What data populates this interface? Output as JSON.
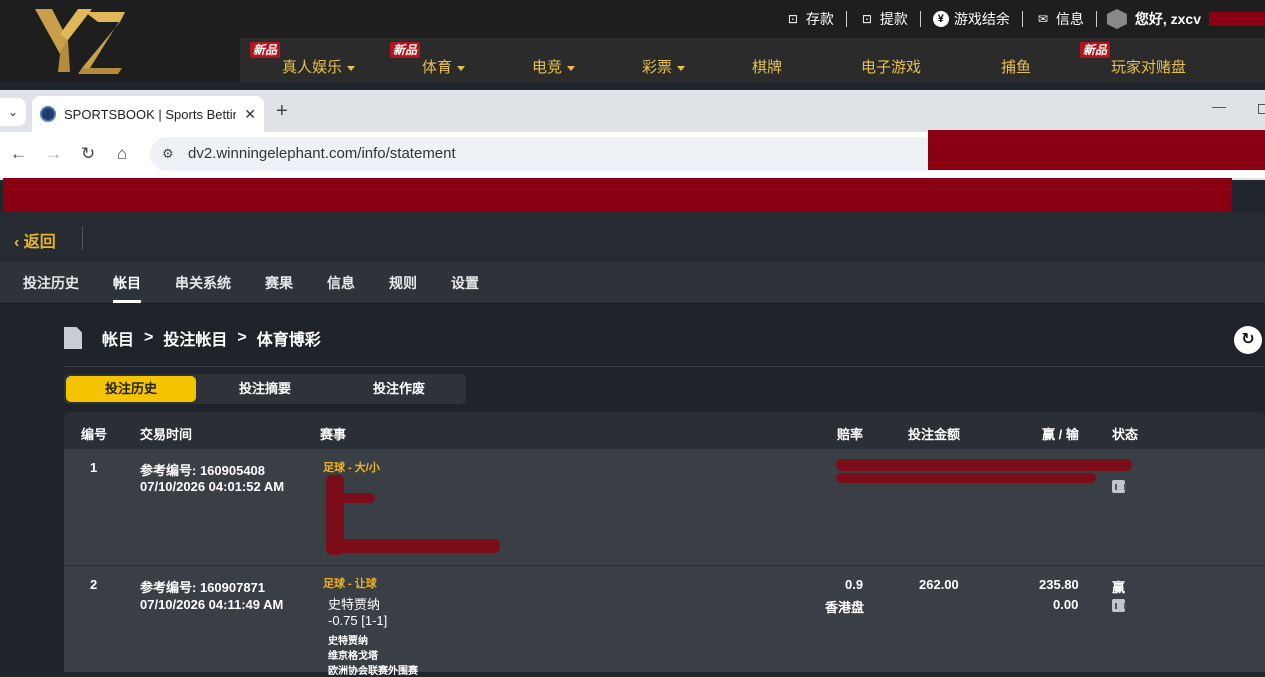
{
  "site": {
    "logo_text": "YZ",
    "top_links": [
      {
        "icon": "deposit-icon",
        "label": "存款"
      },
      {
        "icon": "withdraw-icon",
        "label": "提款"
      },
      {
        "icon": "yen-coin-icon",
        "label": "游戏结余"
      },
      {
        "icon": "mail-icon",
        "label": "信息"
      }
    ],
    "greeting": "您好, zxcv",
    "nav": [
      {
        "label": "真人娱乐",
        "dropdown": true,
        "new": true
      },
      {
        "label": "体育",
        "dropdown": true,
        "new": true
      },
      {
        "label": "电竞",
        "dropdown": true,
        "new": false
      },
      {
        "label": "彩票",
        "dropdown": true,
        "new": false
      },
      {
        "label": "棋牌",
        "dropdown": false,
        "new": false
      },
      {
        "label": "电子游戏",
        "dropdown": false,
        "new": false
      },
      {
        "label": "捕鱼",
        "dropdown": false,
        "new": false
      },
      {
        "label": "玩家对赌盘",
        "dropdown": false,
        "new": true
      }
    ],
    "new_badge": "新品"
  },
  "browser": {
    "tab_title": "SPORTSBOOK | Sports Betting",
    "url": "dv2.winningelephant.com/info/statement"
  },
  "app": {
    "back_label": "返回",
    "tabs": [
      "投注历史",
      "帐目",
      "串关系统",
      "赛果",
      "信息",
      "规则",
      "设置"
    ],
    "active_tab": "帐目",
    "breadcrumb": [
      "帐目",
      "投注帐目",
      "体育博彩"
    ],
    "breadcrumb_sep": ">",
    "segments": [
      "投注历史",
      "投注摘要",
      "投注作废"
    ],
    "table": {
      "headers": {
        "no": "编号",
        "time": "交易时间",
        "event": "赛事",
        "odds": "赔率",
        "stake": "投注金额",
        "winloss": "赢 / 输",
        "status": "状态"
      },
      "rows": [
        {
          "no": "1",
          "ref": "参考编号: 160905408",
          "time": "07/10/2026 04:01:52 AM",
          "sport": "足球 - 大/小"
        },
        {
          "no": "2",
          "ref": "参考编号: 160907871",
          "time": "07/10/2026 04:11:49 AM",
          "sport": "足球 - 让球",
          "selection": "史特贾纳",
          "handicap": "-0.75 [1-1]",
          "home": "史特贾纳",
          "away": "维京格戈塔",
          "league": "欧洲协会联赛外围赛",
          "odds": "0.9",
          "odds_type": "香港盘",
          "stake": "262.00",
          "win": "235.80",
          "loss": "0.00",
          "status": "赢"
        }
      ]
    }
  },
  "colors": {
    "accent_gold": "#e5c04c",
    "active_segment": "#f5c400",
    "redaction": "#8a0013"
  }
}
